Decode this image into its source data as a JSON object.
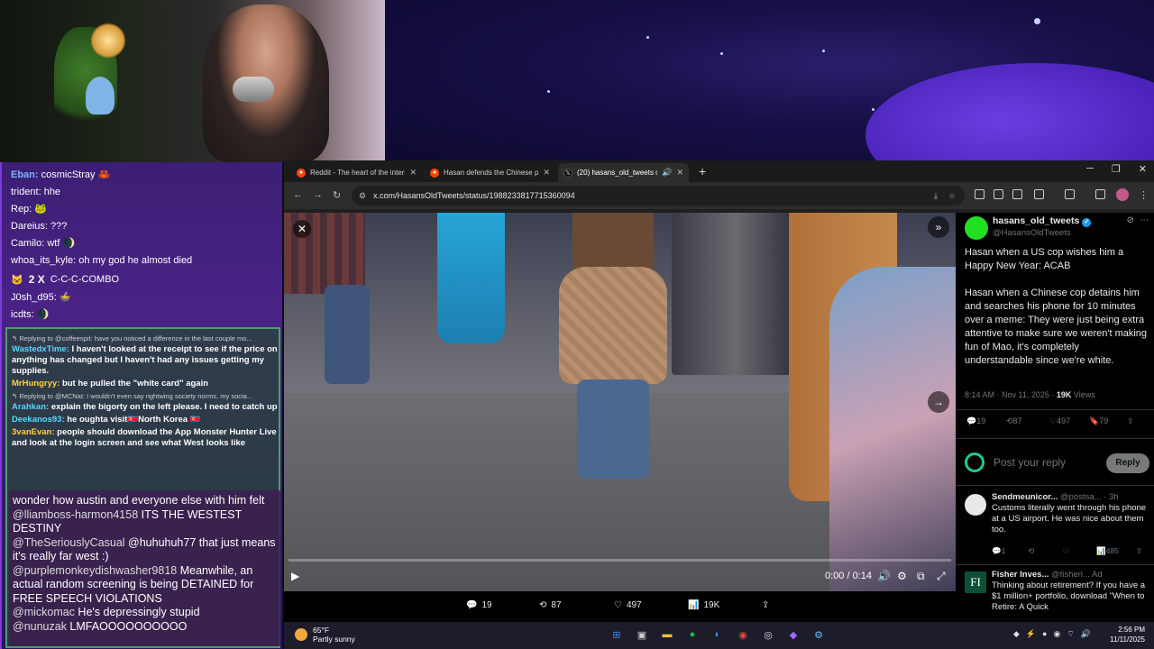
{
  "chat": {
    "top_messages": [
      {
        "user": "Eban:",
        "text": " cosmicStray 🦀"
      },
      {
        "user": "trident:",
        "text": " hhe"
      },
      {
        "user": "Rep:",
        "text": " 🐸"
      },
      {
        "user": "Dareius:",
        "text": " ???"
      },
      {
        "user": "Camilo:",
        "text": " wtf 🌒"
      },
      {
        "user": "whoa_its_kyle:",
        "text": " oh my god he almost died"
      }
    ],
    "combo": {
      "count": "2 X",
      "text": "C-C-C-COMBO"
    },
    "top_messages_2": [
      {
        "user": "J0sh_d95:",
        "text": " 🍲"
      },
      {
        "user": "icdts:",
        "text": " 🌒"
      }
    ],
    "mid_messages": [
      {
        "reply": "↰ Replying to @coffeespit: have you noticed a difference in the last couple mo...",
        "user": "WastedxTime:",
        "text": " I haven't looked at the receipt to see if the price on anything has changed but I haven't had any issues getting my supplies.",
        "color": "#5ad7ff"
      },
      {
        "reply": "",
        "user": "MrHungryy:",
        "text": " but he pulled the \"white card\" again",
        "color": "#ffd23f"
      },
      {
        "reply": "↰ Replying to @MCNat: I wouldn't even say rightwing society norms, my socia...",
        "user": "Arahkan:",
        "text": " explain the bigorty on the left please. I need to catch up",
        "color": "#5ad7ff"
      },
      {
        "reply": "",
        "user": "Deekanos93:",
        "text": " he oughta visit🇰🇵North Korea 🇰🇵",
        "color": "#5ad7ff"
      },
      {
        "reply": "",
        "user": "3vanEvan:",
        "text": " people should download the App Monster Hunter Live and look at the login screen and see what West looks like",
        "color": "#ffd23f"
      }
    ],
    "bottom_messages": [
      {
        "user": "",
        "text": "wonder how austin and everyone else with him felt"
      },
      {
        "user": "@lliamboss-harmon4158",
        "text": " ITS THE WESTEST DESTINY"
      },
      {
        "user": "@TheSeriouslyCasual",
        "text": " @huhuhuh77 that just means it's really far west :)"
      },
      {
        "user": "@purplemonkeydishwasher9818",
        "text": " Meanwhile, an actual random screening is being DETAINED for FREE SPEECH VIOLATIONS"
      },
      {
        "user": "@mickomac",
        "text": " He's depressingly stupid"
      },
      {
        "user": "@nunuzak",
        "text": " LMFAOOOOOOOOOO"
      }
    ]
  },
  "browser": {
    "tabs": [
      {
        "title": "Reddit - The heart of the interne",
        "icon": "reddit-icon",
        "color": "#ff4500"
      },
      {
        "title": "Hasan defends the Chinese poli",
        "icon": "reddit-icon",
        "color": "#ff4500"
      },
      {
        "title": "(20) hasans_old_tweets on",
        "icon": "x-icon",
        "color": "#000000"
      }
    ],
    "url": "x.com/HasansOldTweets/status/1988233817715360094"
  },
  "video": {
    "time": "0:00 / 0:14",
    "progress": 0,
    "actions": {
      "replies": "19",
      "reposts": "87",
      "likes": "497",
      "views": "19K"
    }
  },
  "tweet": {
    "name": "hasans_old_tweets",
    "handle": "@HasansOldTweets",
    "body": "Hasan when a US cop wishes him a Happy New Year: ACAB\n\nHasan when a Chinese cop detains him and searches his phone for 10 minutes over a meme: They were just being extra attentive to make sure we weren't making fun of Mao, it's completely understandable since we're white.",
    "meta": "8:14 AM · Nov 11, 2025 · ",
    "views_count": "19K",
    "views_label": " Views",
    "stats": {
      "replies": "19",
      "reposts": "87",
      "likes": "497",
      "bookmarks": "79"
    },
    "reply_placeholder": "Post your reply",
    "reply_button": "Reply",
    "replies": [
      {
        "name": "Sendmeunicor...",
        "handle": " @postsa... · 3h",
        "text": "Customs literally went through his phone at a US airport. He was nice about them too.",
        "replies": "1",
        "views": "485"
      },
      {
        "name": "Fisher Inves...",
        "handle": " @fisheri...  Ad",
        "text": "Thinking about retirement? If you have a $1 million+ portfolio, download \"When to Retire: A Quick"
      }
    ]
  },
  "taskbar": {
    "weather_temp": "65°F",
    "weather_desc": "Partly sunny",
    "time": "2:56 PM",
    "date": "11/11/2025",
    "apps": [
      {
        "icon": "windows-start-icon",
        "color": "#2b8cff"
      },
      {
        "icon": "task-view-icon",
        "color": "#cccccc"
      },
      {
        "icon": "file-explorer-icon",
        "color": "#f3c13a"
      },
      {
        "icon": "spotify-icon",
        "color": "#1db954"
      },
      {
        "icon": "edge-icon",
        "color": "#2a9df4"
      },
      {
        "icon": "chrome-icon",
        "color": "#e8453c"
      },
      {
        "icon": "obs-icon",
        "color": "#dddddd"
      },
      {
        "icon": "app-icon",
        "color": "#a66cff"
      },
      {
        "icon": "steam-icon",
        "color": "#66c0f4"
      }
    ]
  }
}
